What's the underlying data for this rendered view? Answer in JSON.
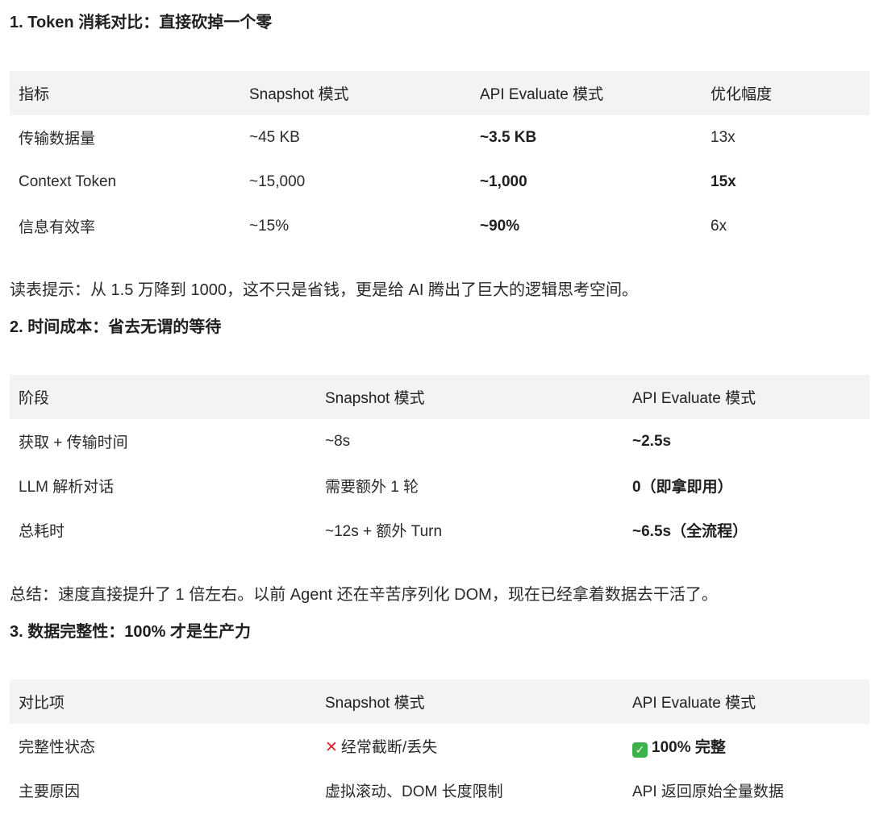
{
  "section1": {
    "title": "1. Token 消耗对比：直接砍掉一个零",
    "headers": [
      "指标",
      "Snapshot 模式",
      "API Evaluate 模式",
      "优化幅度"
    ],
    "rows": [
      [
        "传输数据量",
        "~45 KB",
        "~3.5 KB",
        "13x"
      ],
      [
        "Context Token",
        "~15,000",
        "~1,000",
        "15x"
      ],
      [
        "信息有效率",
        "~15%",
        "~90%",
        "6x"
      ]
    ],
    "note": "读表提示：从 1.5 万降到 1000，这不只是省钱，更是给 AI 腾出了巨大的逻辑思考空间。"
  },
  "section2": {
    "title": "2. 时间成本：省去无谓的等待",
    "headers": [
      "阶段",
      "Snapshot 模式",
      "API Evaluate 模式"
    ],
    "rows": [
      [
        "获取 + 传输时间",
        "~8s",
        "~2.5s"
      ],
      [
        "LLM 解析对话",
        "需要额外 1 轮",
        "0（即拿即用）"
      ],
      [
        "总耗时",
        "~12s + 额外 Turn",
        "~6.5s（全流程）"
      ]
    ],
    "note": "总结：速度直接提升了 1 倍左右。以前 Agent 还在辛苦序列化 DOM，现在已经拿着数据去干活了。"
  },
  "section3": {
    "title": "3. 数据完整性：100% 才是生产力",
    "headers": [
      "对比项",
      "Snapshot 模式",
      "API Evaluate 模式"
    ],
    "rows": [
      [
        "完整性状态",
        "经常截断/丢失",
        "100% 完整"
      ],
      [
        "主要原因",
        "虚拟滚动、DOM 长度限制",
        "API 返回原始全量数据"
      ]
    ],
    "icons": {
      "x_icon": "cross-mark",
      "check_icon": "check-mark-button"
    },
    "x_glyph": "✕",
    "check_glyph": "✓"
  }
}
